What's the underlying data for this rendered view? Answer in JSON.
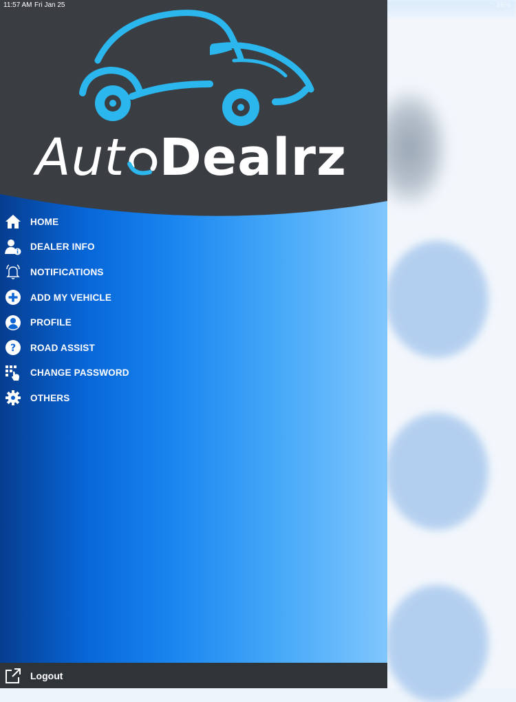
{
  "status_bar": {
    "time": "11:57 AM",
    "date": "Fri Jan 25",
    "battery": "86%"
  },
  "brand": {
    "logo_text_left": "Aut",
    "logo_text_right": "Dealrz",
    "logo_color": "#2bb7ee",
    "header_color": "#3a3d42"
  },
  "menu": {
    "items": [
      {
        "label": "HOME",
        "icon": "home-icon"
      },
      {
        "label": "DEALER INFO",
        "icon": "dealer-info-icon"
      },
      {
        "label": "NOTIFICATIONS",
        "icon": "bell-icon"
      },
      {
        "label": "ADD MY VEHICLE",
        "icon": "plus-circle-icon"
      },
      {
        "label": "PROFILE",
        "icon": "user-circle-icon"
      },
      {
        "label": "ROAD ASSIST",
        "icon": "question-circle-icon"
      },
      {
        "label": "CHANGE PASSWORD",
        "icon": "keypad-icon"
      },
      {
        "label": "OTHERS",
        "icon": "gear-icon"
      }
    ]
  },
  "footer": {
    "logout_label": "Logout",
    "logout_icon": "external-link-icon"
  },
  "colors": {
    "drawer_gradient_start": "#063d8f",
    "drawer_gradient_end": "#80c6fd",
    "footer_bg": "#2f3439"
  }
}
